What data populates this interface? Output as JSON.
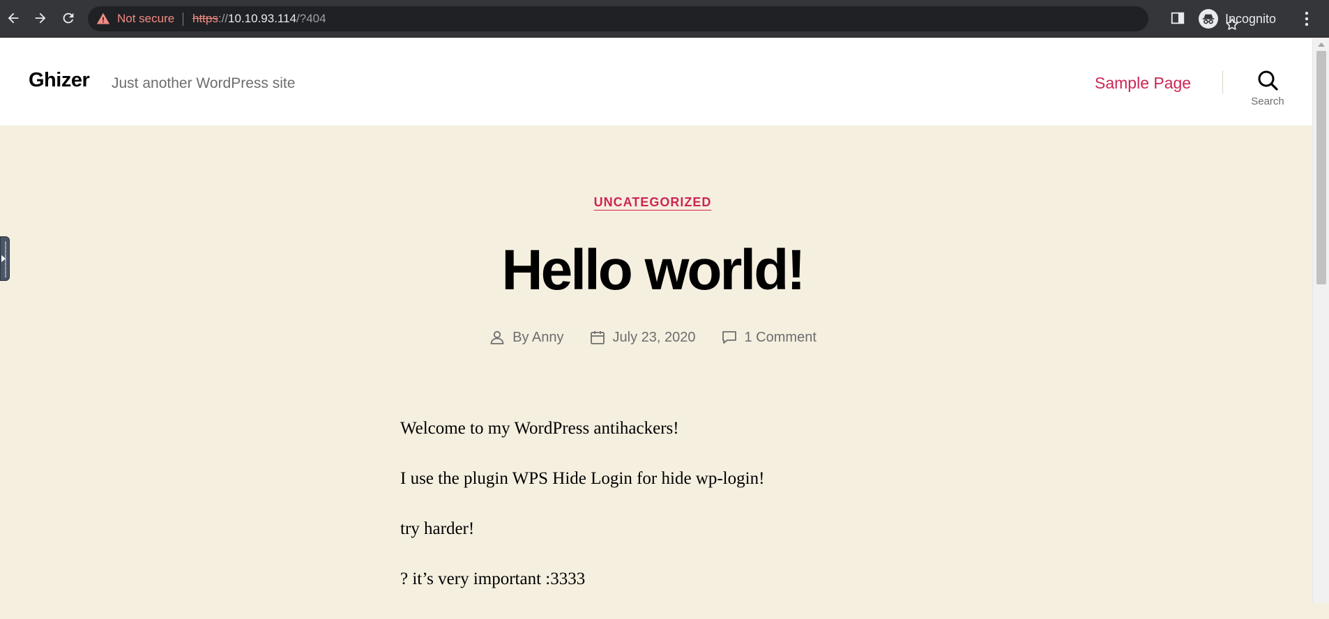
{
  "browser": {
    "security_label": "Not secure",
    "url_scheme": "https",
    "url_scheme_sep": "://",
    "url_host": "10.10.93.114",
    "url_path": "/?404",
    "profile_label": "Incognito"
  },
  "site": {
    "title": "Ghizer",
    "description": "Just another WordPress site",
    "nav_items": [
      "Sample Page"
    ],
    "search_label": "Search"
  },
  "post": {
    "category": "UNCATEGORIZED",
    "title": "Hello world!",
    "author": "By Anny",
    "date": "July 23, 2020",
    "comments": "1 Comment",
    "paragraphs": [
      "Welcome to my WordPress antihackers!",
      "I use the plugin WPS Hide Login for hide wp-login!",
      "try harder!",
      "? it’s very important :3333"
    ]
  },
  "colors": {
    "accent": "#cd2653",
    "background": "#f5efe0",
    "header_bg": "#ffffff"
  }
}
